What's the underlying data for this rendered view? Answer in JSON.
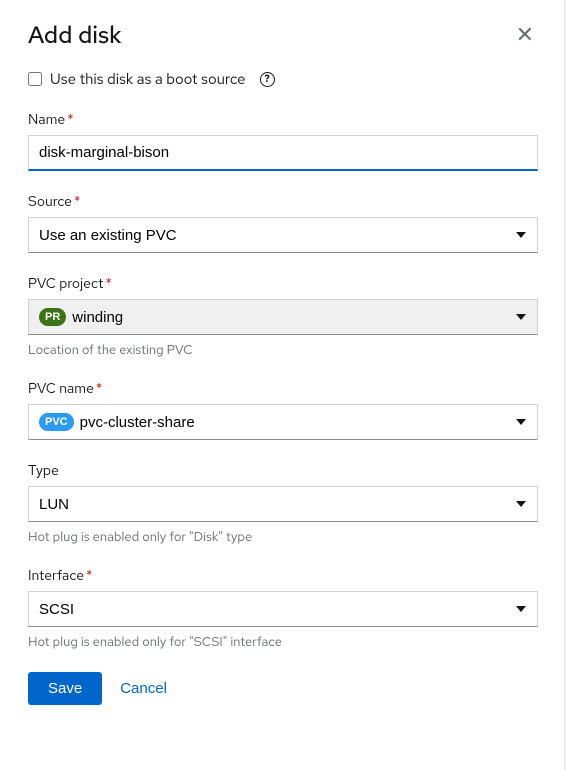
{
  "modal": {
    "title": "Add disk"
  },
  "bootSource": {
    "label": "Use this disk as a boot source"
  },
  "name": {
    "label": "Name",
    "value": "disk-marginal-bison"
  },
  "source": {
    "label": "Source",
    "value": "Use an existing PVC"
  },
  "pvcProject": {
    "label": "PVC project",
    "badge": "PR",
    "value": "winding",
    "helper": "Location of the existing PVC"
  },
  "pvcName": {
    "label": "PVC name",
    "badge": "PVC",
    "value": "pvc-cluster-share"
  },
  "type": {
    "label": "Type",
    "value": "LUN",
    "helper": "Hot plug is enabled only for \"Disk\" type"
  },
  "interface": {
    "label": "Interface",
    "value": "SCSI",
    "helper": "Hot plug is enabled only for \"SCSI\" interface"
  },
  "footer": {
    "save": "Save",
    "cancel": "Cancel"
  }
}
